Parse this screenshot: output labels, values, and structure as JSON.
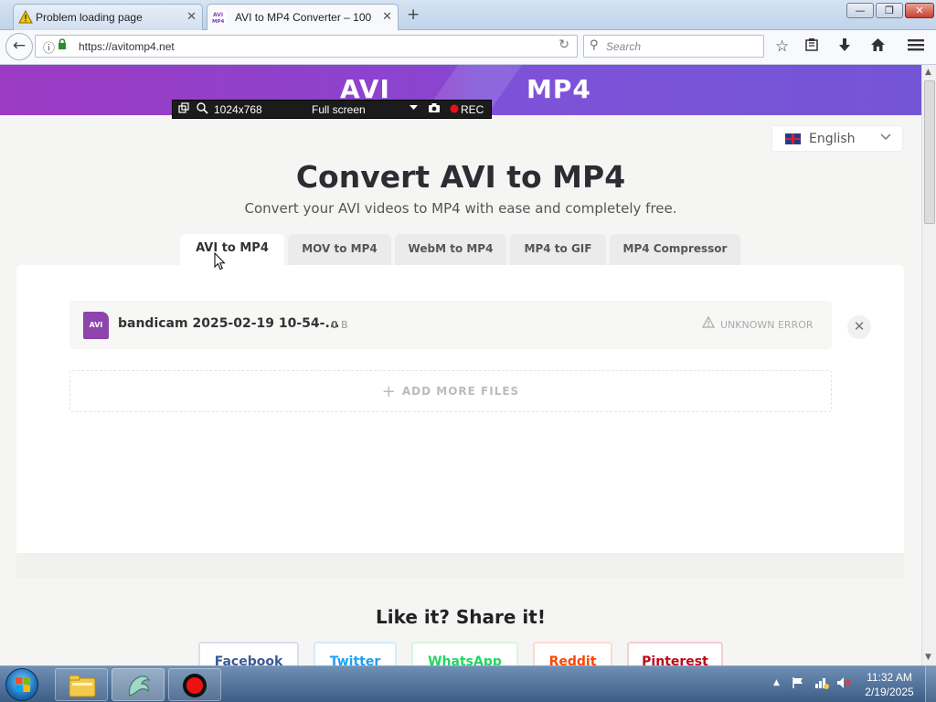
{
  "browser": {
    "tabs": [
      {
        "title": "Problem loading page",
        "close": "✕",
        "active": false
      },
      {
        "title": "AVI to MP4 Converter – 100",
        "close": "✕",
        "active": true
      }
    ],
    "new_tab": "+",
    "window_controls": {
      "minimize": "—",
      "maximize": "❐",
      "close": "✕"
    },
    "url": "https://avitomp4.net",
    "search_placeholder": "Search",
    "icons": [
      "back-icon",
      "info-icon",
      "lock-icon",
      "reload-icon",
      "search-icon",
      "bookmark-star-icon",
      "reading-list-icon",
      "download-icon",
      "home-icon",
      "menu-icon"
    ]
  },
  "recorder_bar": {
    "resolution": "1024x768",
    "mode": "Full screen",
    "rec": "REC"
  },
  "hero": {
    "left": "AVI",
    "right": "MP4"
  },
  "language": {
    "label": "English"
  },
  "page": {
    "title": "Convert AVI to MP4",
    "subtitle": "Convert your AVI videos to MP4 with ease and completely free."
  },
  "converter_tabs": [
    {
      "label": "AVI to MP4",
      "active": true
    },
    {
      "label": "MOV to MP4",
      "active": false
    },
    {
      "label": "WebM to MP4",
      "active": false
    },
    {
      "label": "MP4 to GIF",
      "active": false
    },
    {
      "label": "MP4 Compressor",
      "active": false
    }
  ],
  "file": {
    "type_badge": "AVI",
    "name": "bandicam 2025-02-19 10-54-...",
    "size_value": "0",
    "size_unit": "B",
    "status": "UNKNOWN ERROR"
  },
  "add_more": {
    "label": "ADD MORE FILES"
  },
  "share": {
    "title": "Like it? Share it!",
    "buttons": [
      {
        "label": "Facebook",
        "color": "#3b5998"
      },
      {
        "label": "Twitter",
        "color": "#1da1f2"
      },
      {
        "label": "WhatsApp",
        "color": "#25d366"
      },
      {
        "label": "Reddit",
        "color": "#ff4500"
      },
      {
        "label": "Pinterest",
        "color": "#bd081c"
      }
    ]
  },
  "taskbar": {
    "time": "11:32 AM",
    "date": "2/19/2025"
  },
  "colors": {
    "hero_start": "#9c3bc4",
    "hero_end": "#7455d6",
    "file_badge": "#8e44ad"
  }
}
